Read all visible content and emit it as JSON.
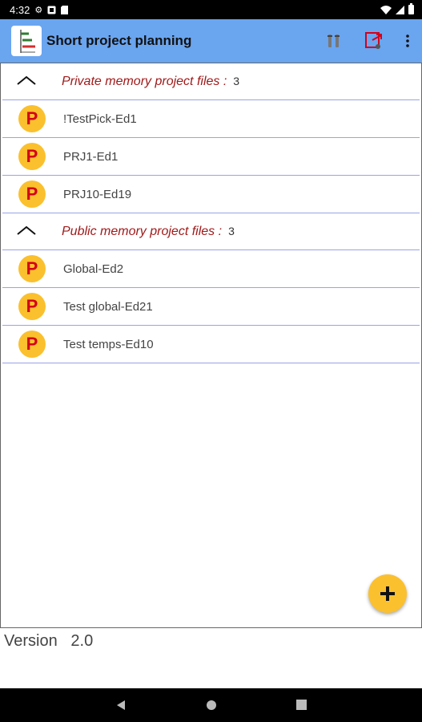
{
  "status_bar": {
    "time": "4:32"
  },
  "app_bar": {
    "title": "Short project planning",
    "color": "#6aa5f0",
    "actions": [
      "settings-tools-icon",
      "export-file-icon",
      "more-vert-icon"
    ]
  },
  "groups": [
    {
      "label": "Private memory project files :",
      "count": "3",
      "items": [
        {
          "badge": "P",
          "name": "!TestPick-Ed1"
        },
        {
          "badge": "P",
          "name": "PRJ1-Ed1"
        },
        {
          "badge": "P",
          "name": "PRJ10-Ed19"
        }
      ]
    },
    {
      "label": "Public memory project files :",
      "count": "3",
      "items": [
        {
          "badge": "P",
          "name": "Global-Ed2"
        },
        {
          "badge": "P",
          "name": "Test global-Ed21"
        },
        {
          "badge": "P",
          "name": "Test temps-Ed10"
        }
      ]
    }
  ],
  "fab": {
    "icon": "add-icon",
    "color": "#fbc02d"
  },
  "version": {
    "label": "Version",
    "value": "2.0"
  },
  "colors": {
    "badge": "#fbc02d",
    "badge_text": "#d4001a",
    "group_label": "#a01a1a",
    "divider": "#9aa3e6"
  }
}
